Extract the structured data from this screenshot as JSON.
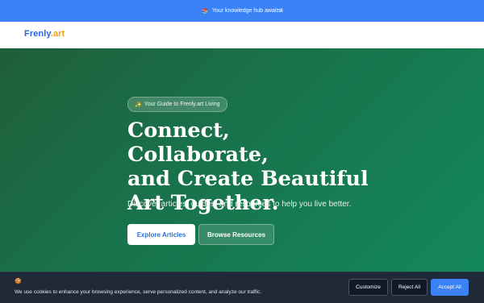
{
  "announcement": {
    "emoji": "📚",
    "text": "Your knowledge hub awaits!",
    "close_label": "×"
  },
  "header": {
    "logo_main": "Frenly",
    "logo_suffix": ".art"
  },
  "hero": {
    "pill_icon": "✨",
    "pill_text": "Your Guide to Frenly.art Living",
    "headline_line1": "Connect, Collaborate,",
    "headline_line2": "and Create Beautiful",
    "headline_line3": "Art Together.",
    "subtitle": "Discover articles, guides, and resources to help you live better.",
    "primary_button": "Explore Articles",
    "secondary_button": "Browse Resources"
  },
  "cookie_banner": {
    "icon": "🍪",
    "text": "We use cookies to enhance your browsing experience, serve personalized content, and analyze our traffic.",
    "customize_label": "Customize",
    "reject_label": "Reject All",
    "accept_label": "Accept All"
  },
  "colors": {
    "announcement_bg": "#3b82f6",
    "logo_blue": "#2563eb",
    "logo_accent": "#f59e0b",
    "hero_green": "#18734c",
    "cookie_bg": "#1f2937",
    "accept_button": "#3b82f6"
  }
}
